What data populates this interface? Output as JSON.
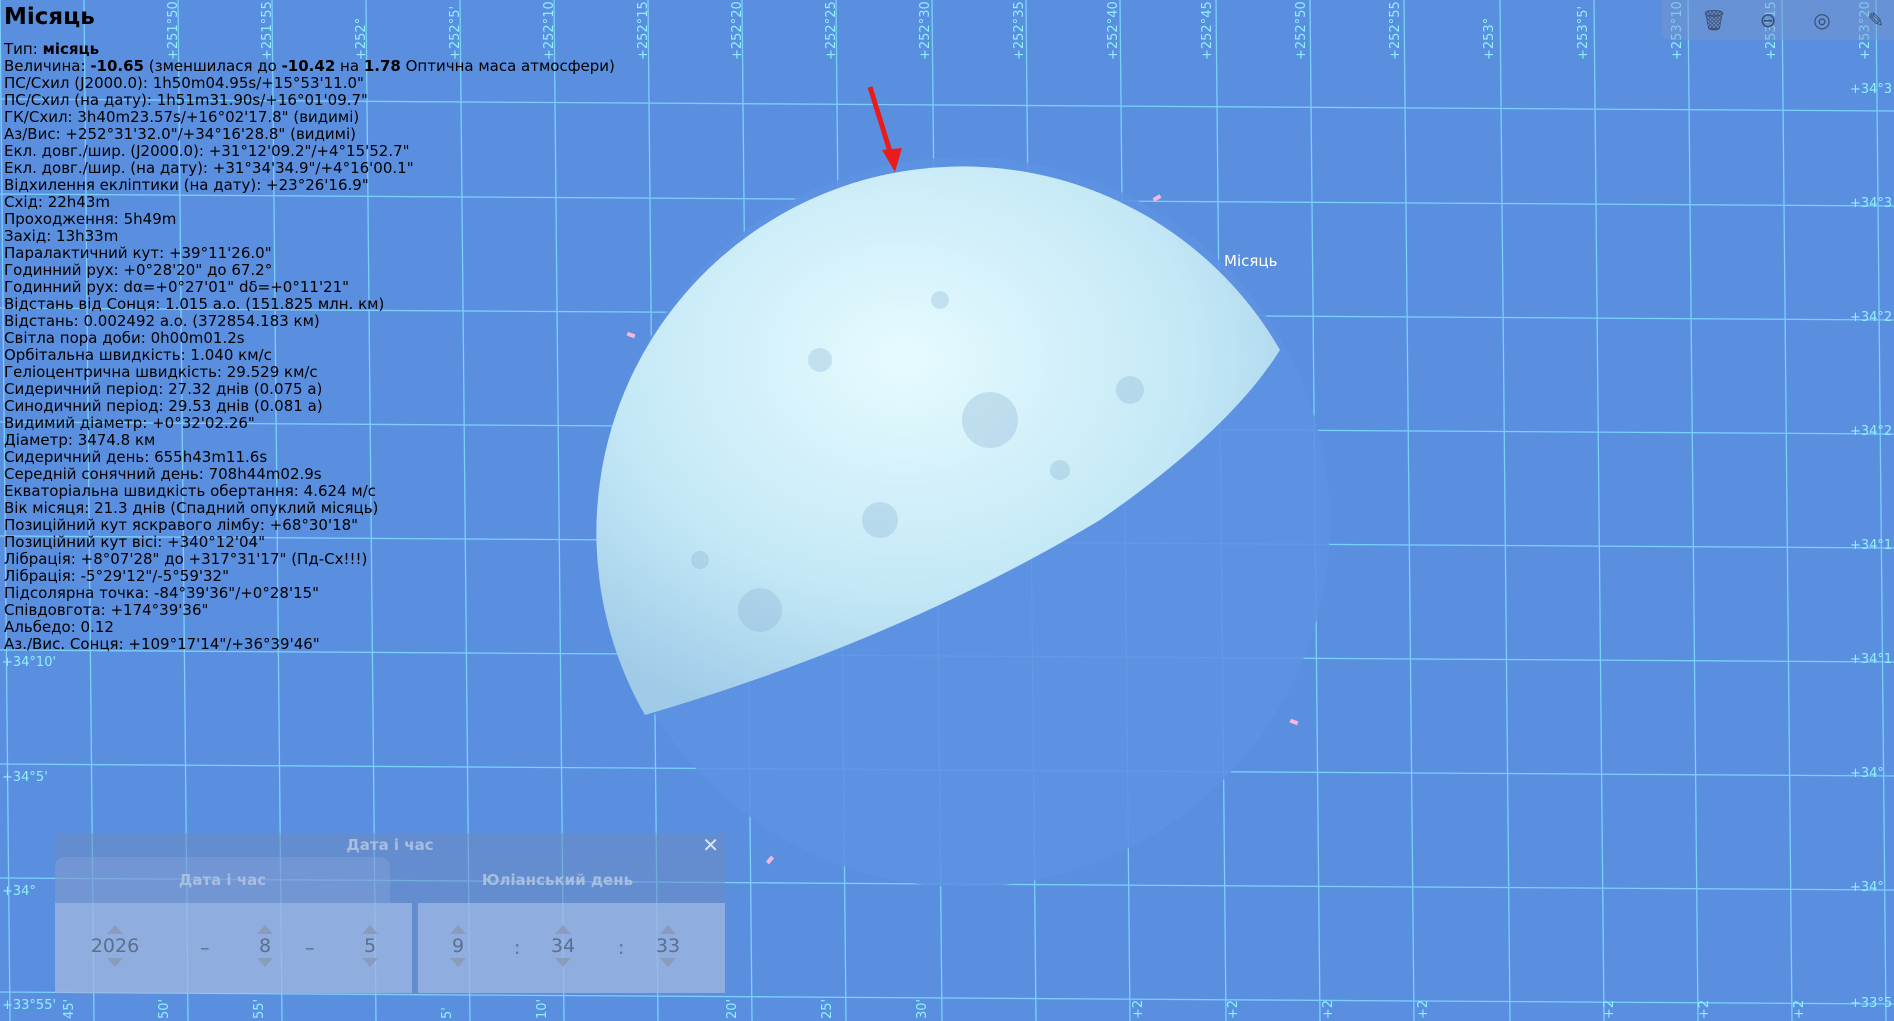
{
  "object_title": "Місяць",
  "sky_label": "Місяць",
  "info": {
    "type_label": "Тип:",
    "type_value": "місяць",
    "magnitude_label": "Величина:",
    "magnitude_value": "-10.65",
    "magnitude_mid1": "(зменшилася до",
    "magnitude_reduced": "-10.42",
    "magnitude_mid2": "на",
    "airmass": "1.78",
    "magnitude_tail": "Оптична маса атмосфери)",
    "rows": [
      "ПС/Схил (J2000.0): 1h50m04.95s/+15°53'11.0\"",
      "ПС/Схил (на дату): 1h51m31.90s/+16°01'09.7\"",
      "ГК/Схил: 3h40m23.57s/+16°02'17.8\" (видимі)",
      "Аз/Вис: +252°31'32.0\"/+34°16'28.8\" (видимі)",
      "Екл. довг./шир. (J2000.0): +31°12'09.2\"/+4°15'52.7\"",
      "Екл. довг./шир. (на дату): +31°34'34.9\"/+4°16'00.1\"",
      "Відхилення екліптики (на дату): +23°26'16.9\"",
      "Схід: 22h43m",
      "Проходження: 5h49m",
      "Захід: 13h33m",
      "Паралактичний кут: +39°11'26.0\"",
      "Годинний рух: +0°28'20\" до 67.2°",
      "Годинний рух: dα=+0°27'01\" dδ=+0°11'21\"",
      "Відстань від Сонця: 1.015 a.o. (151.825 млн. км)",
      "Відстань: 0.002492 a.o. (372854.183 км)",
      "Світла пора доби: 0h00m01.2s",
      "Орбітальна швидкість: 1.040 км/с",
      "Геліоцентрична швидкість: 29.529 км/с",
      "Сидеричний період: 27.32 днів (0.075 a)",
      "Синодичний період: 29.53 днів (0.081 a)",
      "Видимий діаметр: +0°32'02.26\"",
      "Діаметр: 3474.8 км",
      "Сидеричний день: 655h43m11.6s",
      "Середній сонячний день: 708h44m02.9s",
      "Екваторіальна швидкість обертання: 4.624 м/с",
      "Вік місяця: 21.3 днів (Спадний опуклий місяць)",
      "Позиційний кут яскравого лімбу: +68°30'18\"",
      "Позиційний кут вісі: +340°12'04\"",
      "Лібрація: +8°07'28\" до +317°31'17\" (Пд-Сх!!!)",
      "Лібрація: -5°29'12\"/-5°59'32\"",
      "Підсолярна точка: -84°39'36\"/+0°28'15\"",
      "Співдовгота: +174°39'36\"",
      "Альбедо: 0.12",
      "Аз./Вис. Сонця: +109°17'14\"/+36°39'46\""
    ]
  },
  "grid": {
    "top_labels": [
      "+251°50'",
      "+251°55'",
      "+252°",
      "+252°5'",
      "+252°10'",
      "+252°15'",
      "+252°20'",
      "+252°25'",
      "+252°30'",
      "+252°35'",
      "+252°40'",
      "+252°45'",
      "+252°50'",
      "+252°55'",
      "+253°",
      "+253°5'",
      "+253°10'",
      "+253°15'",
      "+253°20'"
    ],
    "left_labels": [
      "+34°10'",
      "+34°5'",
      "+34°",
      "+33°55'"
    ],
    "right_labels": [
      "+34°3",
      "+34°3",
      "+34°2",
      "+34°2",
      "+34°1",
      "+34°1",
      "+34°",
      "+34°",
      "+33°5"
    ],
    "bottom_labels": [
      "45'",
      "50'",
      "55'",
      "5'",
      "10'",
      "20'",
      "25'",
      "30'",
      "+2",
      "+2",
      "+2",
      "+2",
      "+2",
      "+2",
      "+2"
    ]
  },
  "toolbar": {
    "icons": [
      "trash-icon",
      "disc-icon",
      "target-icon",
      "wrench-icon"
    ],
    "glyphs": [
      "🗑",
      "⊖",
      "◎",
      "✎"
    ]
  },
  "dialog": {
    "title": "Дата і час",
    "close_glyph": "✕",
    "tab_datetime": "Дата і час",
    "tab_julian": "Юліанський день",
    "year": "2026",
    "month": "8",
    "day": "5",
    "hour": "9",
    "minute": "34",
    "second": "33",
    "date_sep": "–",
    "time_sep": ":"
  },
  "colors": {
    "sky": "#5a8fe0",
    "grid_line": "#7fdcff",
    "moon_lit": "#c9ecf6",
    "marker_arrow": "#e81c1c"
  }
}
